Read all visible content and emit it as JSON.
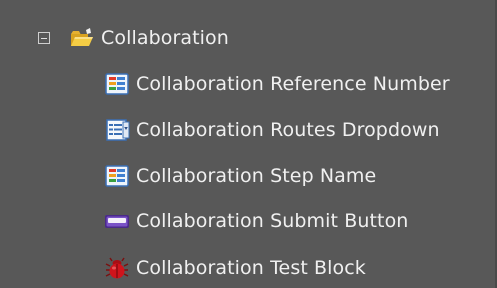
{
  "tree": {
    "folder": {
      "label": "Collaboration",
      "expanded": true,
      "icon": "folder-icon"
    },
    "items": [
      {
        "label": "Collaboration Reference Number",
        "icon": "text-field-icon"
      },
      {
        "label": "Collaboration Routes Dropdown",
        "icon": "dropdown-list-icon"
      },
      {
        "label": "Collaboration Step Name",
        "icon": "text-field-icon"
      },
      {
        "label": "Collaboration Submit Button",
        "icon": "button-icon"
      },
      {
        "label": "Collaboration Test Block",
        "icon": "bug-icon"
      }
    ]
  },
  "colors": {
    "background": "#585858",
    "text": "#f0f0f0",
    "folder": "#f2c230",
    "button": "#6a3fb0",
    "bug": "#c8101a"
  }
}
